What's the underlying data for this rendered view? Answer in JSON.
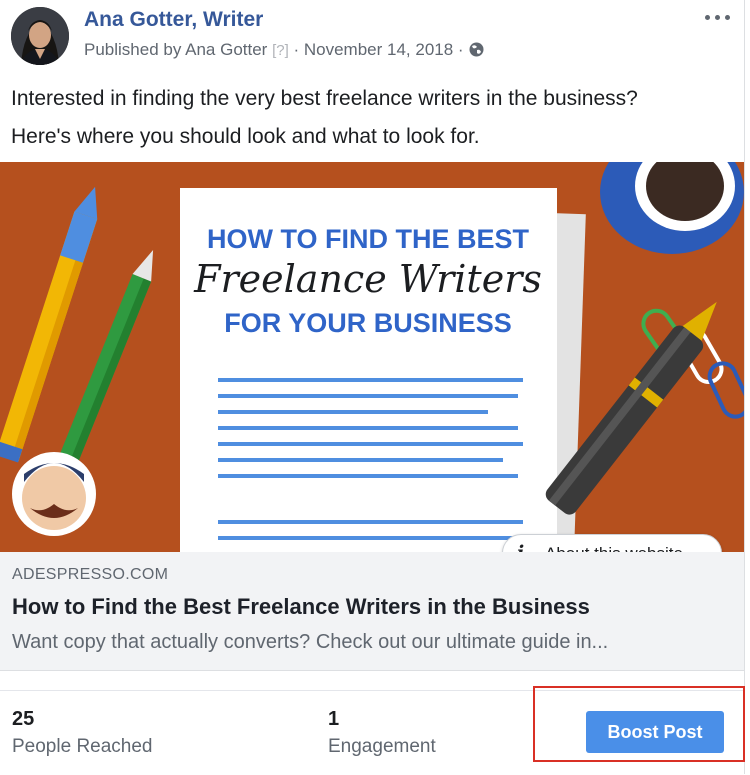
{
  "post": {
    "author": "Ana Gotter, Writer",
    "published_by": "Published by Ana Gotter",
    "help_marker": "[?]",
    "separator": " · ",
    "date": "November 14, 2018",
    "text_line1": "Interested in finding the very best freelance writers in the business?",
    "text_line2": "Here's where you should look and what to look for.",
    "audience_icon": "globe-icon",
    "more_icon": "more-options-icon"
  },
  "image": {
    "headline_top": "HOW TO FIND THE BEST",
    "headline_script": "Freelance Writers",
    "headline_bottom": "FOR YOUR BUSINESS"
  },
  "about_site": {
    "icon": "info-icon",
    "glyph": "i",
    "label": "About this website"
  },
  "link": {
    "domain": "ADESPRESSO.COM",
    "title": "How to Find the Best Freelance Writers in the Business",
    "description": "Want copy that actually converts? Check out our ultimate guide in..."
  },
  "stats": {
    "reached_value": "25",
    "reached_label": "People Reached",
    "engagement_value": "1",
    "engagement_label": "Engagement"
  },
  "actions": {
    "boost_label": "Boost Post"
  },
  "colors": {
    "author_link": "#365899",
    "boost_button": "#4a8fe8",
    "highlight_box": "#d93025",
    "image_background": "#b5501e",
    "headline_blue": "#2f64c8"
  }
}
